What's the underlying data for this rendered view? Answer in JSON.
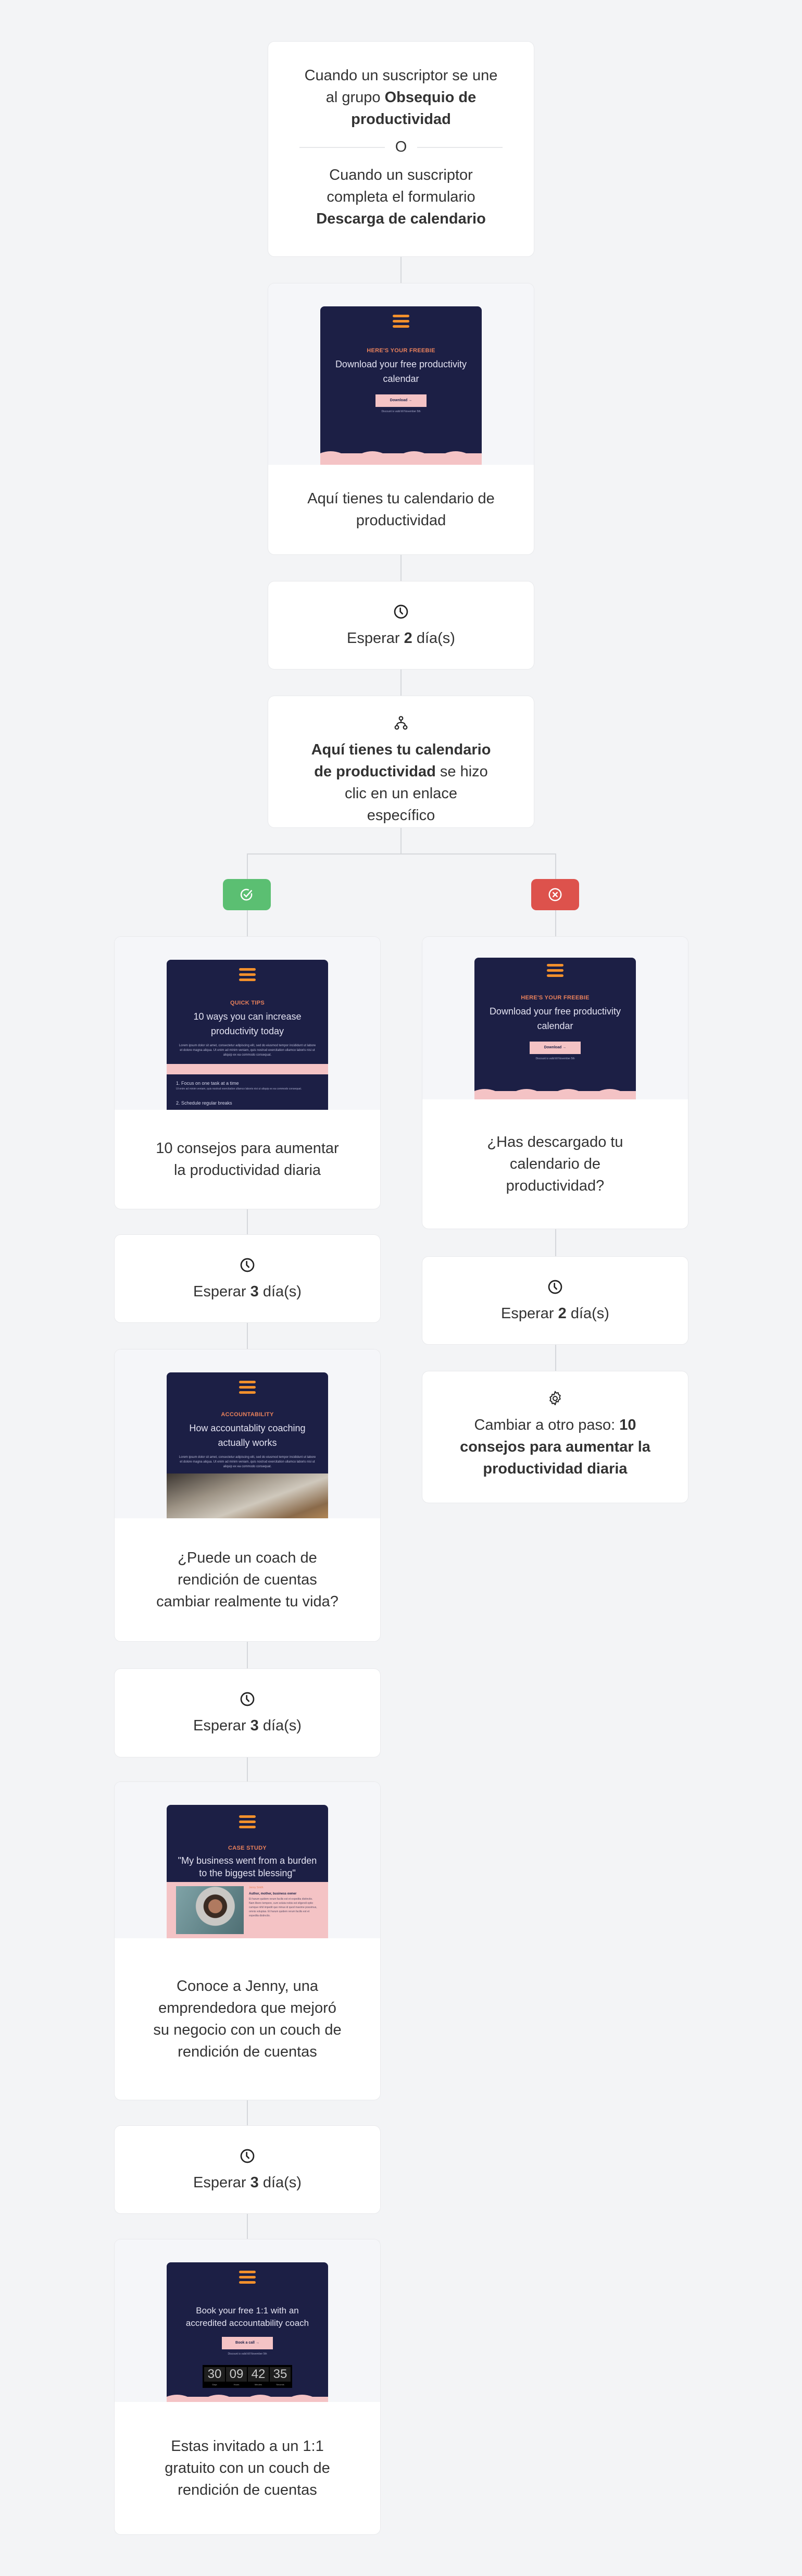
{
  "trigger": {
    "line1_prefix": "Cuando un suscriptor se une al grupo ",
    "line1_bold": "Obsequio de productividad",
    "separator": "O",
    "line2_prefix": "Cuando un suscriptor completa el formulario ",
    "line2_bold": "Descarga de calendario"
  },
  "main_steps": {
    "email1": {
      "title": "Aquí tienes tu calendario de productividad",
      "preview": {
        "kicker": "HERE'S YOUR FREEBIE",
        "headline": "Download your free productivity calendar",
        "button": "Download →",
        "fine_print": "Discount is valid till November 5th"
      }
    },
    "wait1": {
      "prefix": "Esperar ",
      "value": "2",
      "suffix": " día(s)"
    },
    "condition": {
      "bold": "Aquí tienes tu calendario de productividad",
      "rest": " se hizo clic en un enlace específico"
    }
  },
  "branches": {
    "yes": {
      "icon": "check-circle-icon",
      "color": "#5bbf72"
    },
    "no": {
      "icon": "x-circle-icon",
      "color": "#dd524c"
    }
  },
  "yes_path": [
    {
      "type": "email",
      "title": "10 consejos para aumentar la productividad diaria",
      "preview": {
        "kicker": "QUICK TIPS",
        "headline": "10 ways you can increase productivity today",
        "lorem": "Lorem ipsum dolor sit amet, consectetur adipiscing elit, sed do eiusmod tempor incididunt ut labore et dolore magna aliqua. Ut enim ad minim veniam, quis nostrud exercitation ullamco laboris nisi ut aliquip ex ea commodo consequat.",
        "item1": "1. Focus on one task at a time",
        "item1_text": "Ut enim ad minim veniam, quis nostrud exercitation ullamco laboris nisi ut aliquip ex ea commodo consequat.",
        "item2": "2. Schedule regular breaks"
      }
    },
    {
      "type": "wait",
      "prefix": "Esperar ",
      "value": "3",
      "suffix": " día(s)"
    },
    {
      "type": "email",
      "title": "¿Puede un coach de rendición de cuentas cambiar realmente tu vida?",
      "preview": {
        "kicker": "ACCOUNTABILITY",
        "headline": "How accountablity coaching actually works",
        "lorem": "Lorem ipsum dolor sit amet, consectetur adipiscing elit, sed do eiusmod tempor incididunt ut labore et dolore magna aliqua. Ut enim ad minim veniam, quis nostrud exercitation ullamco laboris nisi ut aliquip ex ea commodo consequat."
      }
    },
    {
      "type": "wait",
      "prefix": "Esperar ",
      "value": "3",
      "suffix": " día(s)"
    },
    {
      "type": "email",
      "title": "Conoce a Jenny, una emprendedora que mejoró su negocio con un couch de rendición de cuentas",
      "preview": {
        "kicker": "CASE STUDY",
        "headline": "\"My business went from a burden to the biggest blessing\"",
        "name": "Jenny Smith",
        "role": "Author, mother, business owner",
        "bio": "Et harum quidem rerum facilis est et expedita distinctio. Nam libero tempore, cum soluta nobis est eligendi optio cumque nihil impedit quo minus id quod maxime possimus, omnis voluptas. Et harum quidem rerum facilis est et expedita distinctio."
      }
    },
    {
      "type": "wait",
      "prefix": "Esperar ",
      "value": "3",
      "suffix": " día(s)"
    },
    {
      "type": "email",
      "title": "Estas invitado a un 1:1 gratuito con un couch de rendición de cuentas",
      "preview": {
        "headline": "Book your free 1:1 with an accredited accountability coach",
        "button": "Book a call →",
        "fine_print": "Discount is valid till November 5th",
        "countdown": [
          {
            "value": "30",
            "label": "Days"
          },
          {
            "value": "09",
            "label": "Hours"
          },
          {
            "value": "42",
            "label": "Minutes"
          },
          {
            "value": "35",
            "label": "Seconds"
          }
        ]
      }
    }
  ],
  "no_path": [
    {
      "type": "email",
      "title": "¿Has descargado tu calendario de productividad?",
      "preview": {
        "kicker": "HERE'S YOUR FREEBIE",
        "headline": "Download your free productivity calendar",
        "button": "Download →",
        "fine_print": "Discount is valid till November 5th"
      }
    },
    {
      "type": "wait",
      "prefix": "Esperar ",
      "value": "2",
      "suffix": " día(s)"
    },
    {
      "type": "action",
      "prefix": "Cambiar a otro paso: ",
      "bold": "10 consejos para aumentar la productividad diaria"
    }
  ]
}
